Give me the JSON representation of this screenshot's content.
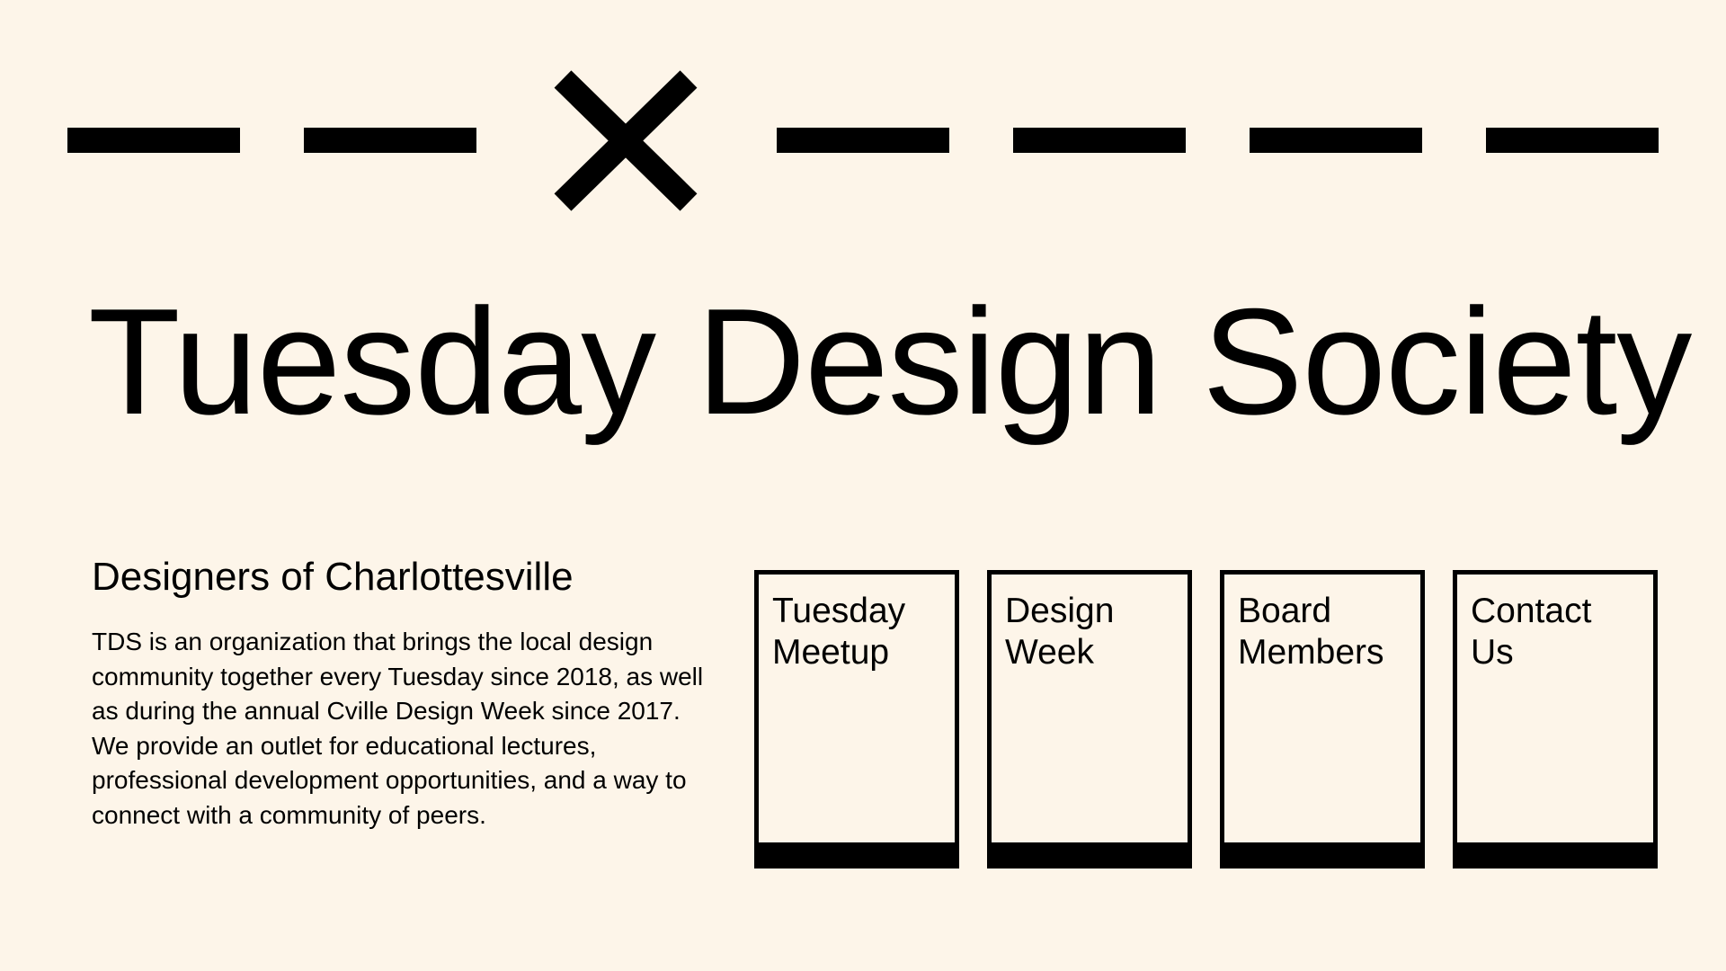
{
  "header": {
    "title": "Tuesday Design Society",
    "close_icon": "x-icon"
  },
  "intro": {
    "heading": "Designers of Charlottesville",
    "body": "TDS is an organization that brings the local design community together every Tuesday since 2018, as well as during the annual Cville Design Week since 2017. We provide an outlet for educational lectures, professional development opportunities, and a way to connect with a community of peers."
  },
  "nav": {
    "cards": [
      {
        "line1": "Tuesday",
        "line2": "Meetup"
      },
      {
        "line1": "Design",
        "line2": "Week"
      },
      {
        "line1": "Board",
        "line2": "Members"
      },
      {
        "line1": "Contact",
        "line2": "Us"
      }
    ]
  },
  "colors": {
    "background": "#fdf5e9",
    "ink": "#000000"
  }
}
